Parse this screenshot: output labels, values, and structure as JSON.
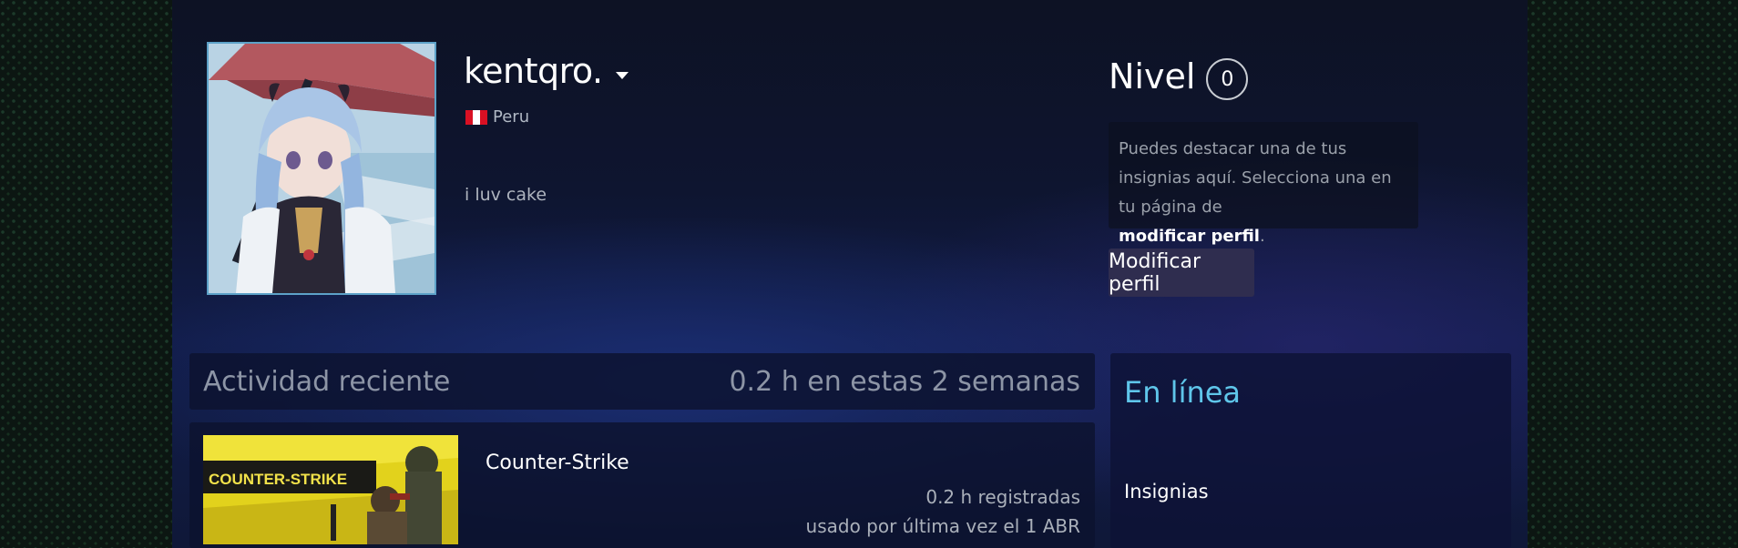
{
  "profile": {
    "persona_name": "kentqro.",
    "country": "Peru",
    "summary": "i luv cake",
    "flag_colors": [
      "#d91023",
      "#ffffff",
      "#d91023"
    ]
  },
  "level": {
    "label": "Nivel",
    "value": "0"
  },
  "badge_notice": {
    "text": "Puedes destacar una de tus insignias aquí. Selecciona una en tu página de",
    "link_text": "modificar perfil",
    "suffix": "."
  },
  "edit_button": {
    "label": "Modificar perfil"
  },
  "recent_activity": {
    "title": "Actividad reciente",
    "summary": "0.2 h en estas 2 semanas",
    "games": [
      {
        "name": "Counter-Strike",
        "hours": "0.2 h registradas",
        "last_played": "usado por última vez el 1 ABR",
        "capsule_logo": "COUNTER-STRIKE"
      }
    ]
  },
  "sidebar": {
    "status": "En línea",
    "badges_label": "Insignias"
  },
  "colors": {
    "accent_online": "#5fc6ea",
    "avatar_border": "#5da2c8",
    "button_bg": "#2f2d4f"
  }
}
